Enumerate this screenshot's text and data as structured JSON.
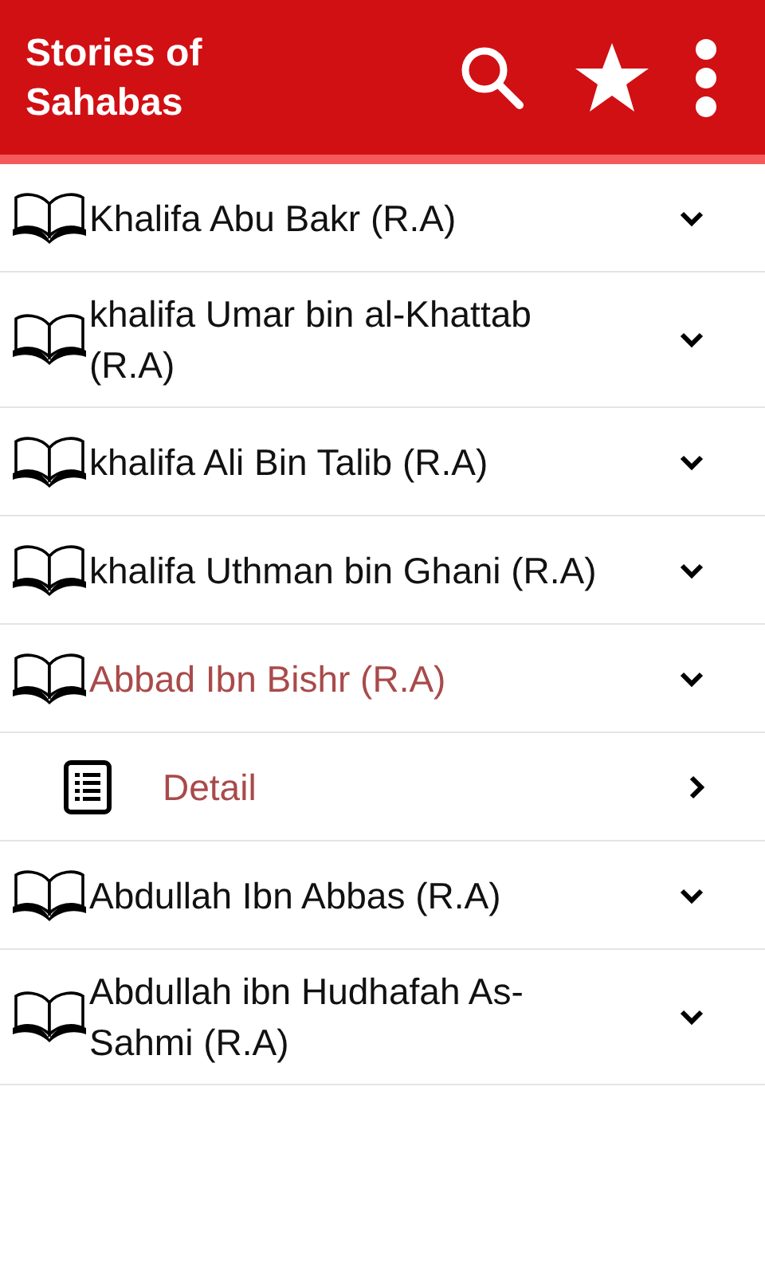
{
  "app_bar": {
    "title": "Stories of Sahabas"
  },
  "groups": [
    {
      "title": "Khalifa Abu Bakr (R.A)",
      "expanded": false
    },
    {
      "title": "khalifa Umar bin al-Khattab (R.A)",
      "expanded": false
    },
    {
      "title": "khalifa Ali Bin Talib (R.A)",
      "expanded": false
    },
    {
      "title": "khalifa Uthman bin Ghani (R.A)",
      "expanded": false
    },
    {
      "title": "Abbad Ibn Bishr (R.A)",
      "expanded": true,
      "children": [
        {
          "title": "Detail"
        }
      ]
    },
    {
      "title": "Abdullah Ibn Abbas (R.A)",
      "expanded": false
    },
    {
      "title": "Abdullah ibn Hudhafah As-Sahmi (R.A)",
      "expanded": false
    }
  ]
}
